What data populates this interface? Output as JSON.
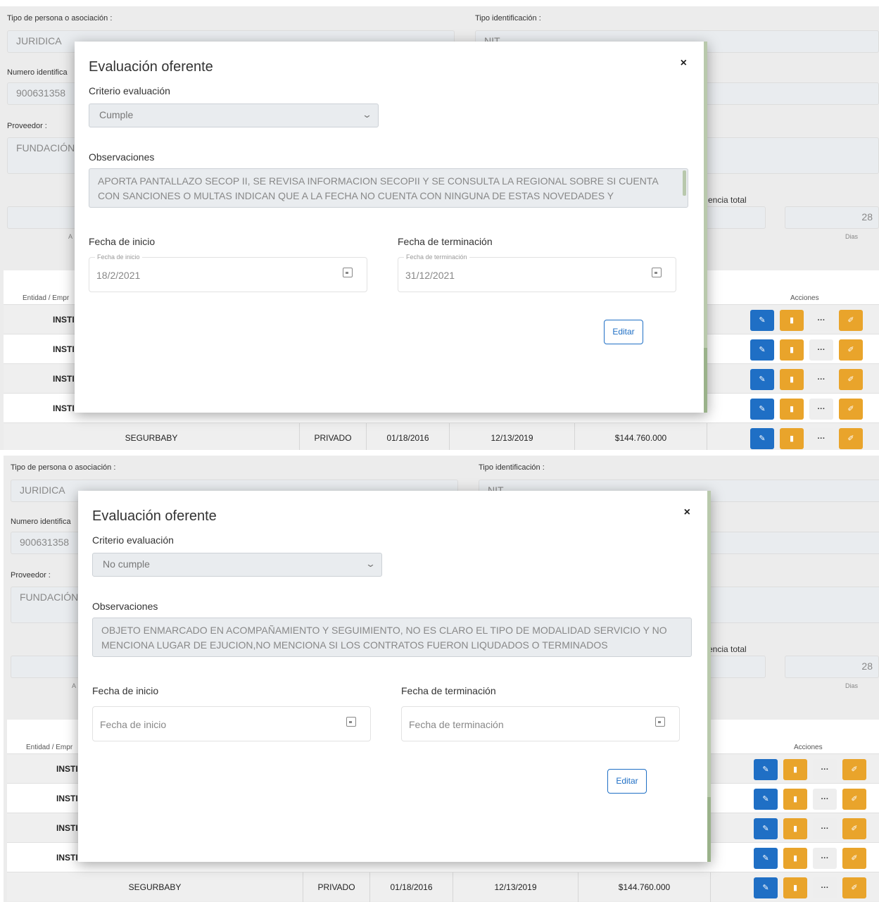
{
  "background": {
    "tipo_persona_label": "Tipo de persona o asociación :",
    "tipo_persona_value": "JURIDICA",
    "tipo_identificacion_label": "Tipo identificación :",
    "tipo_identificacion_value": "NIT",
    "numero_identificacion_label": "Numero identifica",
    "numero_identificacion_value": "900631358",
    "proveedor_label": "Proveedor :",
    "proveedor_value": "FUNDACIÓN",
    "experiencia_label": "encia total",
    "dias_value": "28",
    "dias_label": "Dias",
    "anos_label": "A",
    "table": {
      "col_entidad": "Entidad / Empr",
      "col_acciones": "Acciones",
      "partial_rows": [
        "INSTI",
        "INSTI",
        "INSTI",
        "INSTI"
      ],
      "last_row": {
        "entidad": "SEGURBABY",
        "sector": "PRIVADO",
        "inicio": "01/18/2016",
        "fin": "12/13/2019",
        "valor": "$144.760.000"
      }
    }
  },
  "modals": [
    {
      "title": "Evaluación oferente",
      "close": "×",
      "criterio_label": "Criterio evaluación",
      "criterio_value": "Cumple",
      "observaciones_label": "Observaciones",
      "observaciones_text": "APORTA PANTALLAZO SECOP II, SE REVISA INFORMACION SECOPII Y SE CONSULTA LA REGIONAL SOBRE SI CUENTA CON SANCIONES O MULTAS INDICAN QUE A LA FECHA NO CUENTA CON NINGUNA DE ESTAS NOVEDADES Y",
      "fecha_inicio_label": "Fecha de inicio",
      "fecha_inicio_float": "Fecha de inicio",
      "fecha_inicio_value": "18/2/2021",
      "fecha_fin_label": "Fecha de terminación",
      "fecha_fin_float": "Fecha de terminación",
      "fecha_fin_value": "31/12/2021",
      "edit_label": "Editar"
    },
    {
      "title": "Evaluación oferente",
      "close": "×",
      "criterio_label": "Criterio evaluación",
      "criterio_value": "No cumple",
      "observaciones_label": "Observaciones",
      "observaciones_text": "OBJETO ENMARCADO EN ACOMPAÑAMIENTO Y SEGUIMIENTO, NO ES CLARO EL TIPO DE MODALIDAD SERVICIO Y NO MENCIONA LUGAR DE EJUCION,NO MENCIONA SI LOS CONTRATOS FUERON LIQUDADOS O TERMINADOS",
      "fecha_inicio_label": "Fecha de inicio",
      "fecha_inicio_placeholder": "Fecha de inicio",
      "fecha_fin_label": "Fecha de terminación",
      "fecha_fin_placeholder": "Fecha de terminación",
      "edit_label": "Editar"
    }
  ],
  "icons": {
    "edit": "pencil-icon",
    "delete": "trash-icon",
    "more": "ellipsis-icon",
    "open": "external-edit-icon",
    "calendar": "calendar-icon",
    "dropdown": "chevron-down-icon"
  },
  "colors": {
    "primary": "#1f6fc5",
    "warning": "#e9a42b",
    "readonly_bg": "#e9ecef"
  }
}
